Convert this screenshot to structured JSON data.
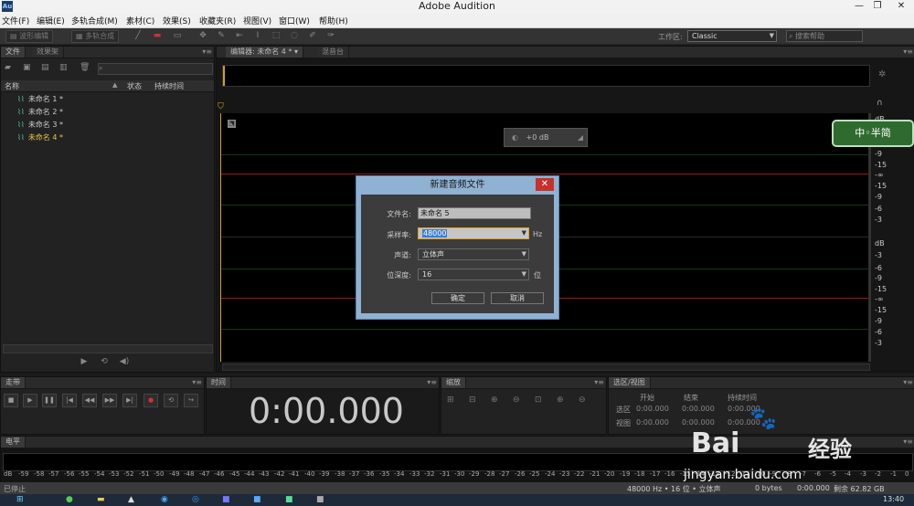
{
  "window": {
    "title": "Adobe Audition",
    "app_icon": "Au"
  },
  "menu": [
    "文件(F)",
    "编辑(E)",
    "多轨合成(M)",
    "素材(C)",
    "效果(S)",
    "收藏夹(R)",
    "视图(V)",
    "窗口(W)",
    "帮助(H)"
  ],
  "toolbar": {
    "waveform_label": "波形编辑",
    "multitrack_label": "多轨合成",
    "workspace_label": "工作区:",
    "workspace_value": "Classic",
    "search_placeholder": "搜索帮助"
  },
  "files_panel": {
    "tabs": [
      "文件",
      "效果架"
    ],
    "columns": [
      "名称",
      "状态",
      "持续时间"
    ],
    "items": [
      {
        "name": "未命名 1 *",
        "selected": false
      },
      {
        "name": "未命名 2 *",
        "selected": false
      },
      {
        "name": "未命名 3 *",
        "selected": false
      },
      {
        "name": "未命名 4 *",
        "selected": true
      }
    ]
  },
  "editor": {
    "tabs": [
      "编辑器: 未命名 4 *",
      "混音台"
    ],
    "gain_hud": "+0 dB",
    "scale_top": [
      "dB",
      "-3",
      "-9",
      "-15",
      "-∞",
      "-15",
      "-9",
      "-6",
      "-3"
    ],
    "scale_bottom": [
      "dB",
      "-3",
      "-6",
      "-9",
      "-15",
      "-∞",
      "-15",
      "-9",
      "-6",
      "-3"
    ]
  },
  "dialog": {
    "title": "新建音频文件",
    "filename_label": "文件名:",
    "filename_value": "未命名 5",
    "samplerate_label": "采样率:",
    "samplerate_value": "48000",
    "samplerate_unit": "Hz",
    "channels_label": "声道:",
    "channels_value": "立体声",
    "bitdepth_label": "位深度:",
    "bitdepth_value": "16",
    "bitdepth_unit": "位",
    "ok_label": "确定",
    "cancel_label": "取消"
  },
  "transport": {
    "tab": "走带",
    "time_tab": "时间",
    "time": "0:00.000",
    "zoom_tab": "缩放"
  },
  "selection": {
    "tab": "选区/视图",
    "headers": [
      "开始",
      "结束",
      "持续时间"
    ],
    "rows": [
      {
        "label": "选区",
        "start": "0:00.000",
        "end": "0:00.000",
        "duration": "0:00.000"
      },
      {
        "label": "视图",
        "start": "0:00.000",
        "end": "0:00.000",
        "duration": "0:00.000"
      }
    ]
  },
  "levels": {
    "tab": "电平",
    "scale": [
      "dB",
      "-59",
      "-58",
      "-57",
      "-56",
      "-55",
      "-54",
      "-53",
      "-52",
      "-51",
      "-50",
      "-49",
      "-48",
      "-47",
      "-46",
      "-45",
      "-44",
      "-43",
      "-42",
      "-41",
      "-40",
      "-39",
      "-38",
      "-37",
      "-36",
      "-35",
      "-34",
      "-33",
      "-32",
      "-31",
      "-30",
      "-29",
      "-28",
      "-27",
      "-26",
      "-25",
      "-24",
      "-23",
      "-22",
      "-21",
      "-20",
      "-19",
      "-18",
      "-17",
      "-16",
      "-15",
      "-14",
      "-13",
      "-12",
      "-11",
      "-10",
      "-9",
      "-8",
      "-7",
      "-6",
      "-5",
      "-4",
      "-3",
      "-2",
      "-1",
      "0"
    ]
  },
  "status": {
    "left": "已停止",
    "format": "48000 Hz • 16 位 • 立体声",
    "bytes": "0 bytes",
    "duration": "0:00.000",
    "free": "剩余 62.82 GB"
  },
  "taskbar": {
    "clock": "13:40"
  },
  "watermark": {
    "badge": "中◦半简",
    "brand": "Bai",
    "brand_cn": "经验",
    "url": "jingyan.baidu.com"
  }
}
